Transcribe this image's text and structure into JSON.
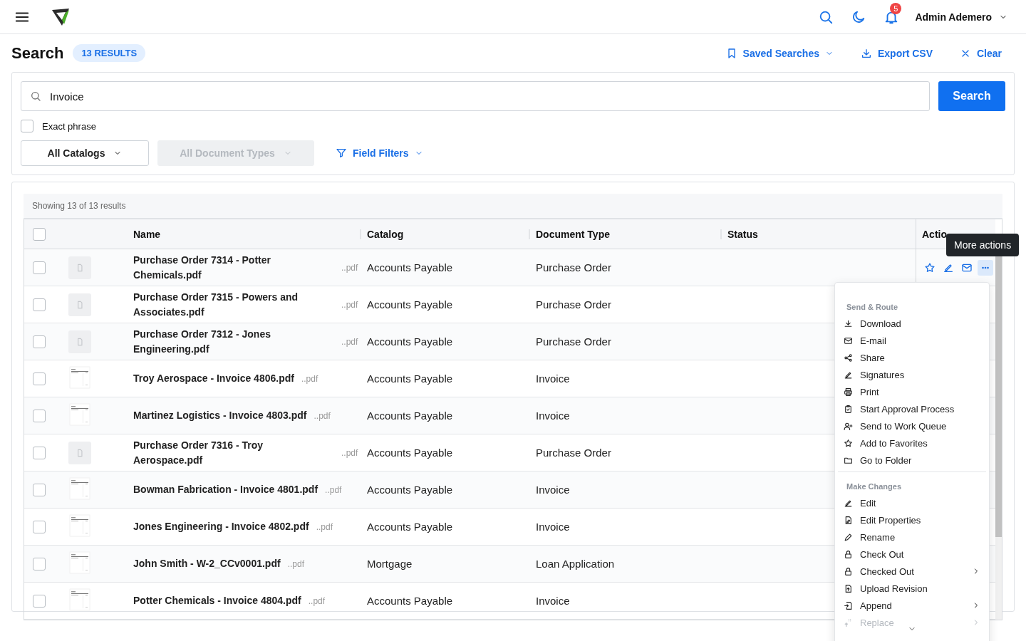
{
  "topbar": {
    "user": "Admin Ademero",
    "notifications": "5"
  },
  "header": {
    "title": "Search",
    "results_badge": "13 RESULTS",
    "actions": [
      "Saved Searches",
      "Export CSV",
      "Clear"
    ]
  },
  "search": {
    "value": "Invoice",
    "button": "Search",
    "exact_phrase": {
      "label": "Exact phrase",
      "checked": false
    },
    "filters": [
      {
        "label": "All Catalogs",
        "disabled": false
      },
      {
        "label": "All Document Types",
        "disabled": true
      }
    ],
    "field_filters": "Field Filters"
  },
  "results": {
    "summary": "Showing 13 of 13 results",
    "select_all": {
      "checked": false
    },
    "columns": [
      "Name",
      "Catalog",
      "Document Type",
      "Status",
      "Actio"
    ],
    "rows": [
      {
        "name": "Purchase Order 7314 - Potter Chemicals.pdf",
        "ext": "..pdf",
        "catalog": "Accounts Payable",
        "document_type": "Purchase Order",
        "kind": "placeholder",
        "checked": false,
        "hover": true
      },
      {
        "name": "Purchase Order 7315 - Powers and Associates.pdf",
        "ext": "..pdf",
        "catalog": "Accounts Payable",
        "document_type": "Purchase Order",
        "kind": "placeholder",
        "checked": false,
        "hover": false
      },
      {
        "name": "Purchase Order 7312 - Jones Engineering.pdf",
        "ext": "..pdf",
        "catalog": "Accounts Payable",
        "document_type": "Purchase Order",
        "kind": "placeholder",
        "checked": false,
        "hover": false
      },
      {
        "name": "Troy Aerospace - Invoice 4806.pdf",
        "ext": "..pdf",
        "catalog": "Accounts Payable",
        "document_type": "Invoice",
        "kind": "page",
        "checked": false,
        "hover": false
      },
      {
        "name": "Martinez Logistics - Invoice 4803.pdf",
        "ext": "..pdf",
        "catalog": "Accounts Payable",
        "document_type": "Invoice",
        "kind": "page",
        "checked": false,
        "hover": false
      },
      {
        "name": "Purchase Order 7316 - Troy Aerospace.pdf",
        "ext": "..pdf",
        "catalog": "Accounts Payable",
        "document_type": "Purchase Order",
        "kind": "placeholder",
        "checked": false,
        "hover": false
      },
      {
        "name": "Bowman Fabrication - Invoice 4801.pdf",
        "ext": "..pdf",
        "catalog": "Accounts Payable",
        "document_type": "Invoice",
        "kind": "page",
        "checked": false,
        "hover": false
      },
      {
        "name": "Jones Engineering - Invoice 4802.pdf",
        "ext": "..pdf",
        "catalog": "Accounts Payable",
        "document_type": "Invoice",
        "kind": "page",
        "checked": false,
        "hover": false
      },
      {
        "name": "John Smith - W-2_CCv0001.pdf",
        "ext": "..pdf",
        "catalog": "Mortgage",
        "document_type": "Loan Application",
        "kind": "page",
        "checked": false,
        "hover": false
      },
      {
        "name": "Potter Chemicals - Invoice 4804.pdf",
        "ext": "..pdf",
        "catalog": "Accounts Payable",
        "document_type": "Invoice",
        "kind": "page",
        "checked": false,
        "hover": false
      }
    ]
  },
  "tooltip": "More actions",
  "menu": {
    "sections": [
      {
        "title": "Send & Route",
        "items": [
          {
            "label": "Download",
            "submenu": false,
            "disabled": false
          },
          {
            "label": "E-mail",
            "submenu": false,
            "disabled": false
          },
          {
            "label": "Share",
            "submenu": false,
            "disabled": false
          },
          {
            "label": "Signatures",
            "submenu": false,
            "disabled": false
          },
          {
            "label": "Print",
            "submenu": false,
            "disabled": false
          },
          {
            "label": "Start Approval Process",
            "submenu": false,
            "disabled": false
          },
          {
            "label": "Send to Work Queue",
            "submenu": false,
            "disabled": false
          },
          {
            "label": "Add to Favorites",
            "submenu": false,
            "disabled": false
          },
          {
            "label": "Go to Folder",
            "submenu": false,
            "disabled": false
          }
        ]
      },
      {
        "title": "Make Changes",
        "items": [
          {
            "label": "Edit",
            "submenu": false,
            "disabled": false
          },
          {
            "label": "Edit Properties",
            "submenu": false,
            "disabled": false
          },
          {
            "label": "Rename",
            "submenu": false,
            "disabled": false
          },
          {
            "label": "Check Out",
            "submenu": false,
            "disabled": false
          },
          {
            "label": "Checked Out",
            "submenu": true,
            "disabled": false
          },
          {
            "label": "Upload Revision",
            "submenu": false,
            "disabled": false
          },
          {
            "label": "Append",
            "submenu": true,
            "disabled": false
          },
          {
            "label": "Replace",
            "submenu": true,
            "disabled": true
          }
        ]
      }
    ]
  }
}
